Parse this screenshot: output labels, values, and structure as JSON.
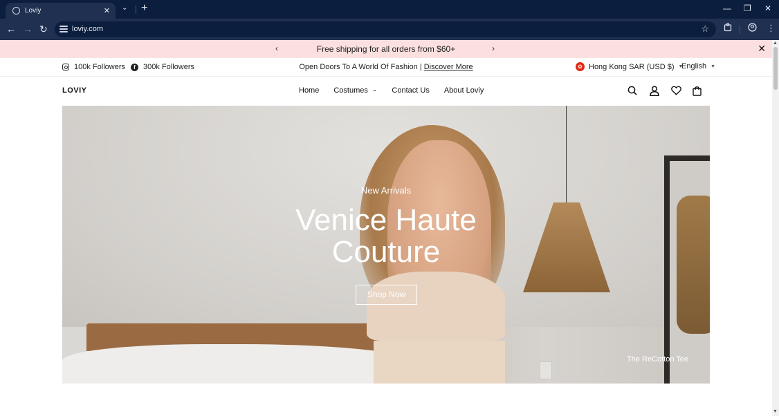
{
  "browser": {
    "tab_title": "Loviy",
    "url": "loviy.com",
    "tab_close": "✕",
    "tab_list": "⌄",
    "new_tab": "+",
    "window": {
      "minimize": "—",
      "restore": "❐",
      "close": "✕"
    },
    "nav": {
      "back": "←",
      "forward": "→",
      "reload": "↻"
    }
  },
  "announcement": {
    "text": "Free shipping for all orders from $60+",
    "prev": "‹",
    "next": "›",
    "close": "✕"
  },
  "utility": {
    "instagram": "100k Followers",
    "facebook": "300k Followers",
    "promo_text": "Open Doors To A World Of Fashion | ",
    "promo_link": "Discover More",
    "region": "Hong Kong SAR (USD $)",
    "language": "English"
  },
  "header": {
    "logo": "LOVIY",
    "nav": [
      "Home",
      "Costumes",
      "Contact Us",
      "About Loviy"
    ]
  },
  "hero": {
    "kicker": "New Arrivals",
    "headline_1": "Venice Haute",
    "headline_2": "Couture",
    "cta": "Shop Now",
    "caption": "The ReCotton Tee"
  }
}
